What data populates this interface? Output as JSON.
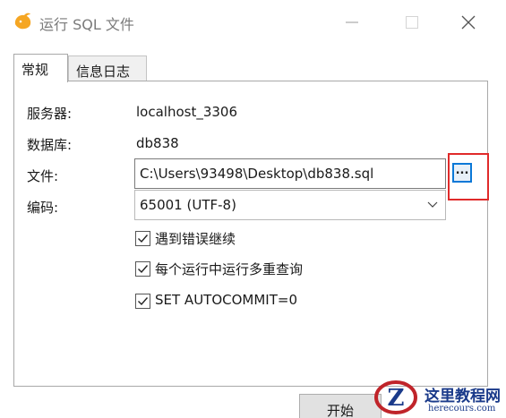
{
  "window": {
    "title": "运行 SQL 文件",
    "icon": "dolphin-icon",
    "controls": [
      "minimize",
      "maximize",
      "close"
    ]
  },
  "tabs": [
    {
      "label": "常规",
      "active": true
    },
    {
      "label": "信息日志",
      "active": false
    }
  ],
  "general": {
    "server_label": "服务器:",
    "server_value": "localhost_3306",
    "database_label": "数据库:",
    "database_value": "db838",
    "file_label": "文件:",
    "file_value": "C:\\Users\\93498\\Desktop\\db838.sql",
    "browse_label": "...",
    "encoding_label": "编码:",
    "encoding_value": "65001 (UTF-8)",
    "options": [
      {
        "label": "遇到错误继续",
        "checked": true
      },
      {
        "label": "每个运行中运行多重查询",
        "checked": true
      },
      {
        "label": "SET AUTOCOMMIT=0",
        "checked": true
      }
    ]
  },
  "footer": {
    "start_label": "开始"
  },
  "watermark": {
    "text": "这里教程网",
    "url": "herecours.com"
  },
  "colors": {
    "accent": "#0a78d7",
    "highlight": "#e02a2a",
    "title_gray": "#7a7a7a",
    "icon_orange": "#f5a623"
  }
}
